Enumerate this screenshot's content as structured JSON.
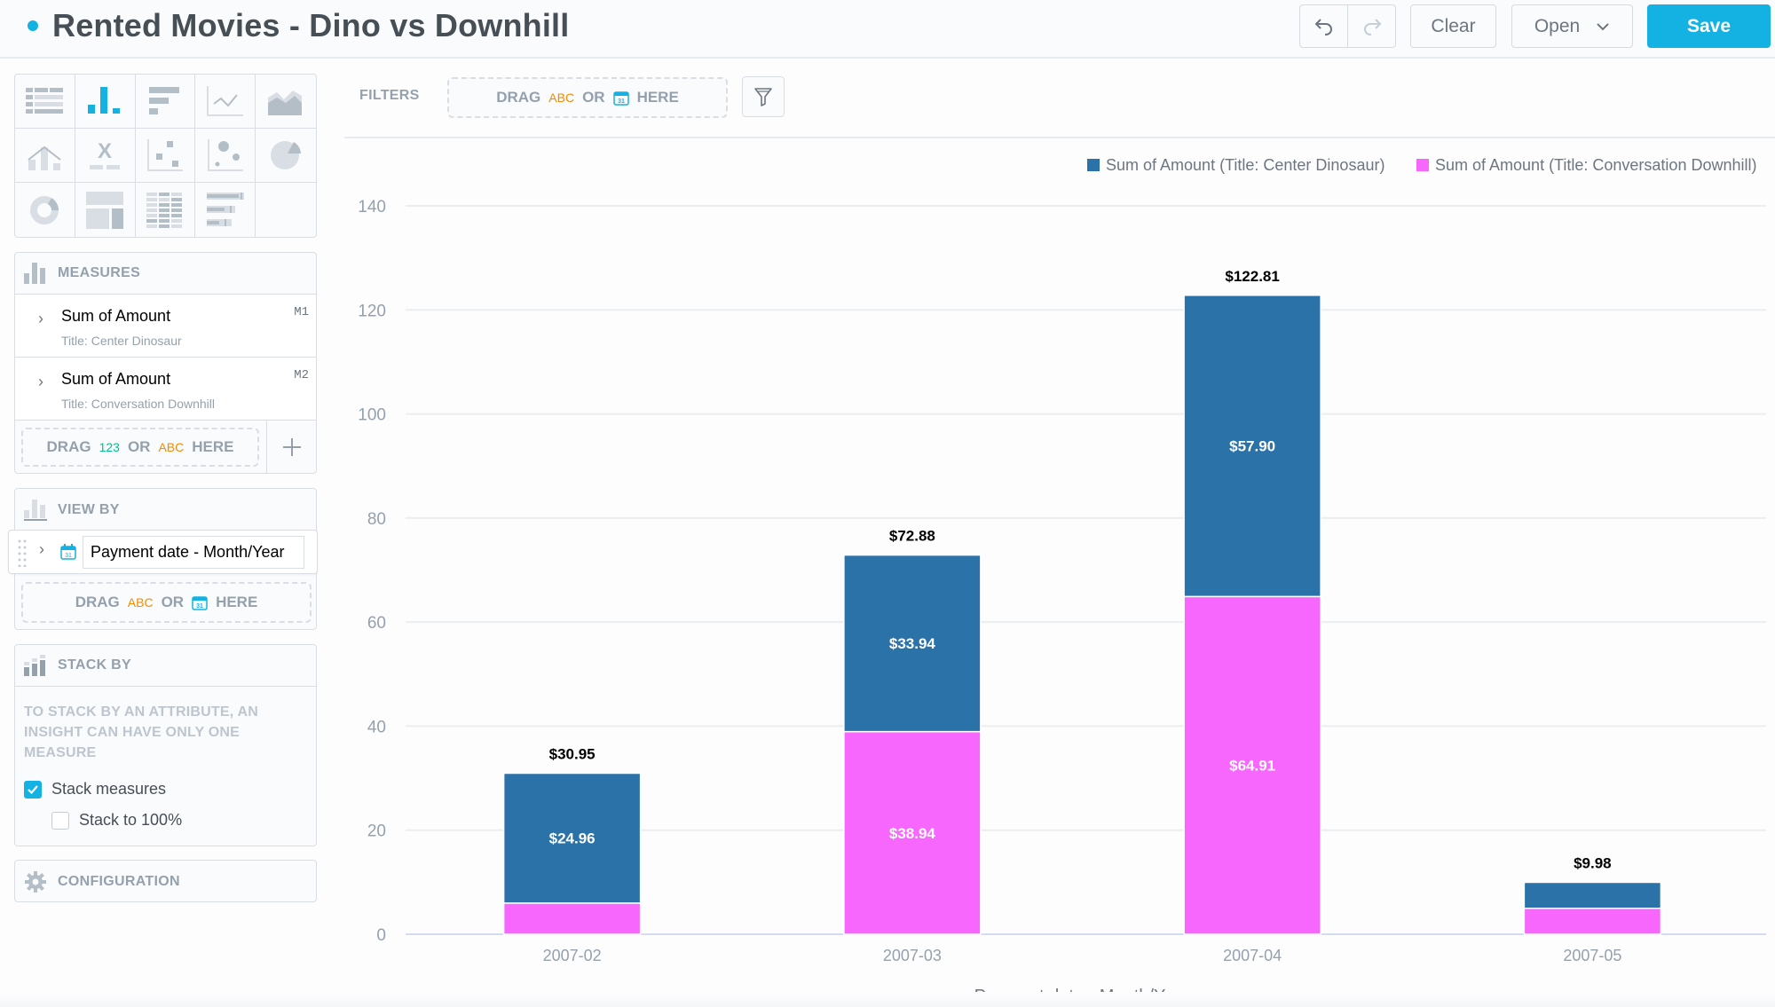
{
  "header": {
    "title": "Rented Movies - Dino vs Downhill",
    "undo_icon": "undo-icon",
    "redo_icon": "redo-icon",
    "clear_label": "Clear",
    "open_label": "Open",
    "save_label": "Save",
    "accent_color": "#14b2e2"
  },
  "sidebar": {
    "viz_types": [
      {
        "name": "table-icon",
        "active": false
      },
      {
        "name": "column-chart-icon",
        "active": true
      },
      {
        "name": "bar-chart-icon",
        "active": false
      },
      {
        "name": "line-chart-icon",
        "active": false
      },
      {
        "name": "area-chart-icon",
        "active": false
      },
      {
        "name": "combo-chart-icon",
        "active": false
      },
      {
        "name": "headline-icon",
        "active": false
      },
      {
        "name": "scatter-plot-icon",
        "active": false
      },
      {
        "name": "bubble-chart-icon",
        "active": false
      },
      {
        "name": "pie-chart-icon",
        "active": false
      },
      {
        "name": "donut-chart-icon",
        "active": false
      },
      {
        "name": "treemap-icon",
        "active": false
      },
      {
        "name": "heatmap-icon",
        "active": false
      },
      {
        "name": "bullet-chart-icon",
        "active": false
      }
    ],
    "measures": {
      "title": "MEASURES",
      "items": [
        {
          "name": "Sum of Amount",
          "subtitle": "Title: Center Dinosaur",
          "id": "M1"
        },
        {
          "name": "Sum of Amount",
          "subtitle": "Title: Conversation Downhill",
          "id": "M2"
        }
      ],
      "drop": {
        "drag": "DRAG",
        "num": "123",
        "or": "OR",
        "abc": "ABC",
        "here": "HERE"
      }
    },
    "view_by": {
      "title": "VIEW BY",
      "item": "Payment date - Month/Year",
      "drop": {
        "drag": "DRAG",
        "abc": "ABC",
        "or": "OR",
        "here": "HERE"
      }
    },
    "stack_by": {
      "title": "STACK BY",
      "message": "TO STACK BY AN ATTRIBUTE, AN INSIGHT CAN HAVE ONLY ONE MEASURE",
      "stack_measures_label": "Stack measures",
      "stack_measures_checked": true,
      "stack_100_label": "Stack to 100%",
      "stack_100_checked": false
    },
    "configuration": {
      "title": "CONFIGURATION"
    }
  },
  "filters": {
    "label": "FILTERS",
    "drop": {
      "drag": "DRAG",
      "abc": "ABC",
      "or": "OR",
      "here": "HERE"
    }
  },
  "chart_data": {
    "type": "bar",
    "stacked": true,
    "categories": [
      "2007-02",
      "2007-03",
      "2007-04",
      "2007-05"
    ],
    "series": [
      {
        "name": "Sum of Amount (Title: Conversation Downhill)",
        "color": "#f766fd",
        "values": [
          5.99,
          38.94,
          64.91,
          4.99
        ],
        "labels": [
          "",
          "$38.94",
          "$64.91",
          ""
        ]
      },
      {
        "name": "Sum of Amount (Title: Center Dinosaur)",
        "color": "#2b72a8",
        "values": [
          24.96,
          33.94,
          57.9,
          4.99
        ],
        "labels": [
          "$24.96",
          "$33.94",
          "$57.90",
          ""
        ]
      }
    ],
    "totals": [
      30.95,
      72.88,
      122.81,
      9.98
    ],
    "total_labels": [
      "$30.95",
      "$72.88",
      "$122.81",
      "$9.98"
    ],
    "legend": [
      {
        "name": "Sum of Amount (Title: Center Dinosaur)",
        "color": "#2b72a8"
      },
      {
        "name": "Sum of Amount (Title: Conversation Downhill)",
        "color": "#f766fd"
      }
    ],
    "legend_position": "top-right",
    "title": "",
    "xlabel": "Payment date - Month/Year",
    "ylabel": "",
    "ylim": [
      0,
      140
    ],
    "yticks": [
      0,
      20,
      40,
      60,
      80,
      100,
      120,
      140
    ],
    "grid": true
  }
}
